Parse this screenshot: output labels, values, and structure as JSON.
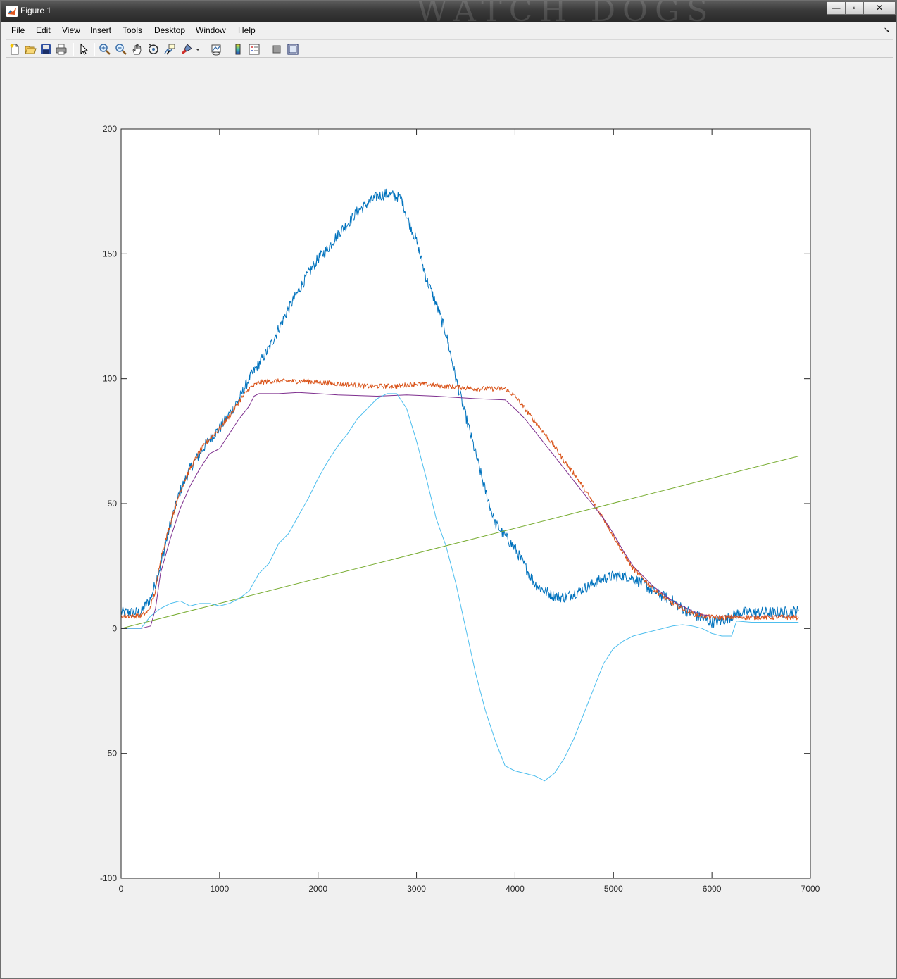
{
  "window": {
    "title": "Figure 1",
    "title_deco": "WATCH DOGS",
    "minimize_glyph": "—",
    "maximize_glyph": "▫",
    "close_glyph": "✕"
  },
  "menu": {
    "items": [
      "File",
      "Edit",
      "View",
      "Insert",
      "Tools",
      "Desktop",
      "Window",
      "Help"
    ],
    "dock_glyph": "↘"
  },
  "toolbar": {
    "icons": [
      "new-figure-icon",
      "open-file-icon",
      "save-icon",
      "print-icon",
      "edit-plot-arrow-icon",
      "zoom-in-icon",
      "zoom-out-icon",
      "pan-hand-icon",
      "rotate-3d-icon",
      "data-cursor-icon",
      "brush-icon",
      "brush-dropdown-icon",
      "link-plot-icon",
      "insert-colorbar-icon",
      "insert-legend-icon",
      "hide-plot-tools-icon",
      "show-plot-tools-icon"
    ]
  },
  "chart_data": {
    "type": "line",
    "xlim": [
      0,
      7000
    ],
    "ylim": [
      -100,
      200
    ],
    "xticks": [
      0,
      1000,
      2000,
      3000,
      4000,
      5000,
      6000,
      7000
    ],
    "yticks": [
      -100,
      -50,
      0,
      50,
      100,
      150,
      200
    ],
    "grid": false,
    "box": true,
    "series": [
      {
        "color": "#0072bd",
        "noise": 2.2,
        "points": [
          [
            0,
            6.5
          ],
          [
            200,
            6.5
          ],
          [
            300,
            12
          ],
          [
            400,
            25
          ],
          [
            500,
            42
          ],
          [
            600,
            55
          ],
          [
            700,
            64
          ],
          [
            800,
            70
          ],
          [
            900,
            76
          ],
          [
            1000,
            80
          ],
          [
            1100,
            86
          ],
          [
            1200,
            92
          ],
          [
            1300,
            100
          ],
          [
            1400,
            106
          ],
          [
            1500,
            112
          ],
          [
            1600,
            120
          ],
          [
            1700,
            128
          ],
          [
            1800,
            135
          ],
          [
            1900,
            142
          ],
          [
            2000,
            148
          ],
          [
            2100,
            152
          ],
          [
            2200,
            158
          ],
          [
            2300,
            162
          ],
          [
            2400,
            167
          ],
          [
            2500,
            170
          ],
          [
            2600,
            173
          ],
          [
            2700,
            174
          ],
          [
            2800,
            173
          ],
          [
            2850,
            172
          ],
          [
            2900,
            165
          ],
          [
            3000,
            155
          ],
          [
            3100,
            140
          ],
          [
            3200,
            130
          ],
          [
            3300,
            118
          ],
          [
            3400,
            100
          ],
          [
            3500,
            85
          ],
          [
            3600,
            70
          ],
          [
            3700,
            55
          ],
          [
            3800,
            42
          ],
          [
            3900,
            37
          ],
          [
            4000,
            32
          ],
          [
            4100,
            25
          ],
          [
            4200,
            18
          ],
          [
            4300,
            15
          ],
          [
            4400,
            13
          ],
          [
            4500,
            12.5
          ],
          [
            4600,
            14
          ],
          [
            4700,
            16
          ],
          [
            4800,
            18
          ],
          [
            4900,
            20
          ],
          [
            5000,
            21
          ],
          [
            5100,
            21
          ],
          [
            5200,
            20
          ],
          [
            5300,
            18
          ],
          [
            5400,
            15
          ],
          [
            5500,
            13
          ],
          [
            5600,
            11
          ],
          [
            5700,
            8
          ],
          [
            5800,
            6
          ],
          [
            5900,
            4
          ],
          [
            6000,
            2.5
          ],
          [
            6100,
            3
          ],
          [
            6200,
            5
          ],
          [
            6300,
            6.5
          ],
          [
            6400,
            6.5
          ],
          [
            6500,
            6.5
          ],
          [
            6600,
            6.5
          ],
          [
            6700,
            6.5
          ],
          [
            6880,
            7
          ]
        ]
      },
      {
        "color": "#d95319",
        "noise": 1.0,
        "points": [
          [
            0,
            5
          ],
          [
            200,
            5
          ],
          [
            280,
            7
          ],
          [
            350,
            15
          ],
          [
            400,
            28
          ],
          [
            500,
            42
          ],
          [
            600,
            55
          ],
          [
            700,
            64
          ],
          [
            800,
            71
          ],
          [
            900,
            76
          ],
          [
            1000,
            80
          ],
          [
            1100,
            85
          ],
          [
            1200,
            91
          ],
          [
            1300,
            96
          ],
          [
            1400,
            98.5
          ],
          [
            1500,
            99
          ],
          [
            1700,
            99
          ],
          [
            1900,
            99
          ],
          [
            2000,
            98.5
          ],
          [
            2200,
            98
          ],
          [
            2500,
            97
          ],
          [
            2800,
            97
          ],
          [
            3000,
            98
          ],
          [
            3300,
            97
          ],
          [
            3600,
            96
          ],
          [
            3900,
            96
          ],
          [
            4000,
            93
          ],
          [
            4100,
            88
          ],
          [
            4200,
            83
          ],
          [
            4300,
            78
          ],
          [
            4400,
            73
          ],
          [
            4500,
            67
          ],
          [
            4600,
            62
          ],
          [
            4700,
            56
          ],
          [
            4800,
            50
          ],
          [
            4900,
            44
          ],
          [
            5000,
            37
          ],
          [
            5100,
            30
          ],
          [
            5200,
            24
          ],
          [
            5300,
            20
          ],
          [
            5400,
            16
          ],
          [
            5500,
            13
          ],
          [
            5600,
            10
          ],
          [
            5700,
            8
          ],
          [
            5800,
            6
          ],
          [
            5900,
            5
          ],
          [
            6000,
            4.5
          ],
          [
            6200,
            4.5
          ],
          [
            6500,
            4.5
          ],
          [
            6880,
            4.5
          ]
        ]
      },
      {
        "color": "#7e2f8e",
        "noise": 0,
        "points": [
          [
            0,
            0
          ],
          [
            200,
            0
          ],
          [
            300,
            1
          ],
          [
            350,
            8
          ],
          [
            400,
            22
          ],
          [
            500,
            36
          ],
          [
            600,
            48
          ],
          [
            700,
            57
          ],
          [
            800,
            64
          ],
          [
            900,
            70
          ],
          [
            1000,
            72
          ],
          [
            1100,
            78
          ],
          [
            1200,
            84
          ],
          [
            1300,
            89
          ],
          [
            1350,
            93
          ],
          [
            1400,
            94
          ],
          [
            1600,
            94
          ],
          [
            1800,
            94.5
          ],
          [
            2000,
            94
          ],
          [
            2200,
            93.5
          ],
          [
            2600,
            93
          ],
          [
            2900,
            93.5
          ],
          [
            3200,
            93
          ],
          [
            3600,
            92
          ],
          [
            3900,
            91.5
          ],
          [
            4000,
            88
          ],
          [
            4100,
            84
          ],
          [
            4200,
            79
          ],
          [
            4300,
            74
          ],
          [
            4400,
            69
          ],
          [
            4500,
            64
          ],
          [
            4600,
            59
          ],
          [
            4700,
            54
          ],
          [
            4800,
            49
          ],
          [
            4900,
            44
          ],
          [
            5000,
            38
          ],
          [
            5100,
            31
          ],
          [
            5200,
            25
          ],
          [
            5300,
            21
          ],
          [
            5400,
            17
          ],
          [
            5500,
            14
          ],
          [
            5600,
            11
          ],
          [
            5700,
            9
          ],
          [
            5800,
            7
          ],
          [
            5900,
            5.5
          ],
          [
            6000,
            5
          ],
          [
            6200,
            5
          ],
          [
            6500,
            5
          ],
          [
            6880,
            5
          ]
        ]
      },
      {
        "color": "#77ac30",
        "noise": 0,
        "points": [
          [
            0,
            0
          ],
          [
            6880,
            69
          ]
        ]
      },
      {
        "color": "#4dbeee",
        "noise": 0,
        "points": [
          [
            0,
            0
          ],
          [
            200,
            0
          ],
          [
            300,
            5
          ],
          [
            400,
            8
          ],
          [
            500,
            10
          ],
          [
            600,
            11
          ],
          [
            700,
            9
          ],
          [
            800,
            10
          ],
          [
            900,
            10
          ],
          [
            1000,
            9
          ],
          [
            1100,
            10
          ],
          [
            1200,
            12
          ],
          [
            1300,
            15
          ],
          [
            1400,
            22
          ],
          [
            1500,
            26
          ],
          [
            1600,
            34
          ],
          [
            1700,
            38
          ],
          [
            1800,
            45
          ],
          [
            1900,
            52
          ],
          [
            2000,
            60
          ],
          [
            2100,
            67
          ],
          [
            2200,
            73
          ],
          [
            2300,
            78
          ],
          [
            2400,
            84
          ],
          [
            2500,
            88
          ],
          [
            2600,
            92
          ],
          [
            2700,
            94
          ],
          [
            2800,
            94
          ],
          [
            2900,
            88
          ],
          [
            3000,
            75
          ],
          [
            3100,
            60
          ],
          [
            3200,
            44
          ],
          [
            3300,
            33
          ],
          [
            3400,
            18
          ],
          [
            3500,
            0
          ],
          [
            3600,
            -18
          ],
          [
            3700,
            -33
          ],
          [
            3800,
            -45
          ],
          [
            3900,
            -55
          ],
          [
            4000,
            -57
          ],
          [
            4100,
            -58
          ],
          [
            4200,
            -59
          ],
          [
            4300,
            -61
          ],
          [
            4400,
            -58
          ],
          [
            4500,
            -52
          ],
          [
            4600,
            -44
          ],
          [
            4700,
            -34
          ],
          [
            4800,
            -24
          ],
          [
            4900,
            -14
          ],
          [
            5000,
            -8
          ],
          [
            5100,
            -5
          ],
          [
            5200,
            -3
          ],
          [
            5300,
            -2
          ],
          [
            5400,
            -1
          ],
          [
            5500,
            0
          ],
          [
            5600,
            1
          ],
          [
            5700,
            1.5
          ],
          [
            5800,
            1
          ],
          [
            5900,
            0
          ],
          [
            6000,
            -2
          ],
          [
            6100,
            -3
          ],
          [
            6200,
            -3
          ],
          [
            6250,
            3
          ],
          [
            6400,
            2.5
          ],
          [
            6600,
            2.5
          ],
          [
            6880,
            2.5
          ]
        ]
      }
    ]
  }
}
